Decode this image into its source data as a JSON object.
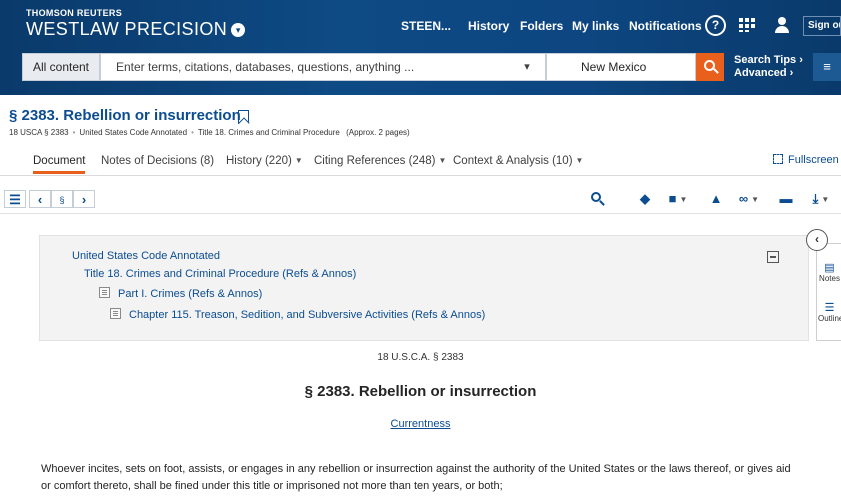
{
  "header": {
    "brand_small": "THOMSON REUTERS",
    "brand_big": "WESTLAW PRECISION",
    "brand_caret": "▾",
    "nav": {
      "user": "STEEN...",
      "history": "History",
      "folders": "Folders",
      "my_links": "My links",
      "notifications": "Notifications"
    },
    "help_icon": "?",
    "sign_out": "Sign out"
  },
  "search": {
    "scope": "All content",
    "placeholder": "Terms, citations, databases, questions, anything ...",
    "placeholder_shown": "Enter terms, citations, databases, questions, anything ...",
    "dropdown_chevron": "▾",
    "jurisdiction": "New Mexico",
    "tips": "Search Tips ›",
    "advanced": "Advanced ›",
    "filter_icon": "≡"
  },
  "document": {
    "title": "§ 2383. Rebellion or insurrection",
    "meta": {
      "cite": "18 USCA § 2383",
      "collection": "United States Code Annotated",
      "title_ref": "Title 18. Crimes and Criminal Procedure",
      "length": "(Approx. 2 pages)"
    }
  },
  "tabs": {
    "document": "Document",
    "notes": "Notes of Decisions (8)",
    "history": "History (220)",
    "citing": "Citing References (248)",
    "context": "Context & Analysis (10)",
    "fullscreen": "Fullscreen"
  },
  "toolbar": {
    "list_icon": "☰",
    "prev": "‹",
    "section": "§",
    "next": "›",
    "search_icon": "🔍",
    "tag_icon": "◆",
    "note_icon": "■",
    "bell_icon": "▲",
    "link_icon": "∞",
    "folder_icon": "▬",
    "download_icon": "⤓",
    "more_icon": "▾"
  },
  "toc": {
    "level1": "United States Code Annotated",
    "level2": "Title 18. Crimes and Criminal Procedure (Refs & Annos)",
    "level3": "Part I. Crimes (Refs & Annos)",
    "level4": "Chapter 115. Treason, Sedition, and Subversive Activities (Refs & Annos)"
  },
  "rail": {
    "toggle": "‹",
    "notes": "Notes",
    "outline": "Outline"
  },
  "body": {
    "citation": "18 U.S.C.A. § 2383",
    "heading": "§ 2383. Rebellion or insurrection",
    "currentness": "Currentness",
    "text": "Whoever incites, sets on foot, assists, or engages in any rebellion or insurrection against the authority of the United States or the laws thereof, or gives aid or comfort thereto, shall be fined under this title or imprisoned not more than ten years, or both;"
  },
  "colors": {
    "header_blue": "#0d4680",
    "link_blue": "#0b4d90",
    "accent_orange": "#e8601b"
  }
}
